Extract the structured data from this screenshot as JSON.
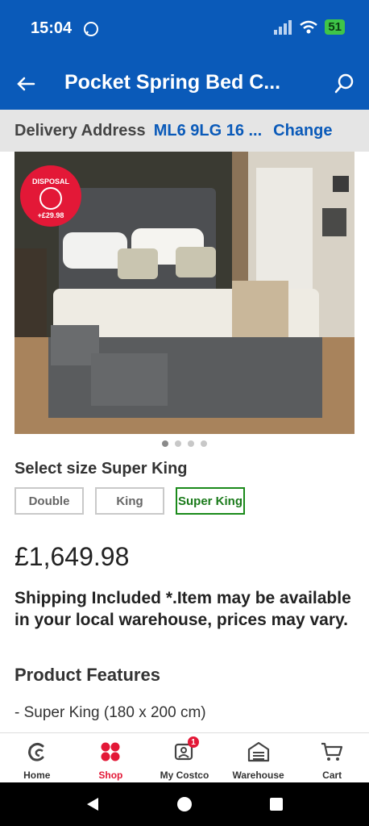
{
  "status_bar": {
    "time": "15:04",
    "battery": "51"
  },
  "app_bar": {
    "title": "Pocket Spring Bed C...",
    "icons": [
      "back-arrow-icon",
      "search-icon"
    ]
  },
  "delivery": {
    "label": "Delivery Address",
    "address": "ML6 9LG 16 ...",
    "change_label": "Change"
  },
  "product_image": {
    "badge_text": "DISPOSAL",
    "badge_price": "+£29.98",
    "carousel_count": 4,
    "active_index": 0
  },
  "size": {
    "heading": "Select size Super King",
    "options": [
      {
        "label": "Double",
        "selected": false
      },
      {
        "label": "King",
        "selected": false
      },
      {
        "label": "Super King",
        "selected": true
      }
    ]
  },
  "price": "£1,649.98",
  "shipping_note": "Shipping Included *.Item may be available in your local warehouse, prices may vary.",
  "features": {
    "heading": "Product Features",
    "items": [
      "- Super King (180 x 200 cm)"
    ]
  },
  "bottom_nav": {
    "items": [
      {
        "label": "Home",
        "icon": "home-c-icon"
      },
      {
        "label": "Shop",
        "icon": "shop-grid-icon",
        "active": true
      },
      {
        "label": "My Costco",
        "icon": "my-costco-icon",
        "badge": "1"
      },
      {
        "label": "Warehouse",
        "icon": "warehouse-icon"
      },
      {
        "label": "Cart",
        "icon": "cart-icon"
      }
    ]
  },
  "colors": {
    "brand_blue": "#0a5ab9",
    "accent_red": "#e31837",
    "selected_green": "#1a8a1a"
  }
}
